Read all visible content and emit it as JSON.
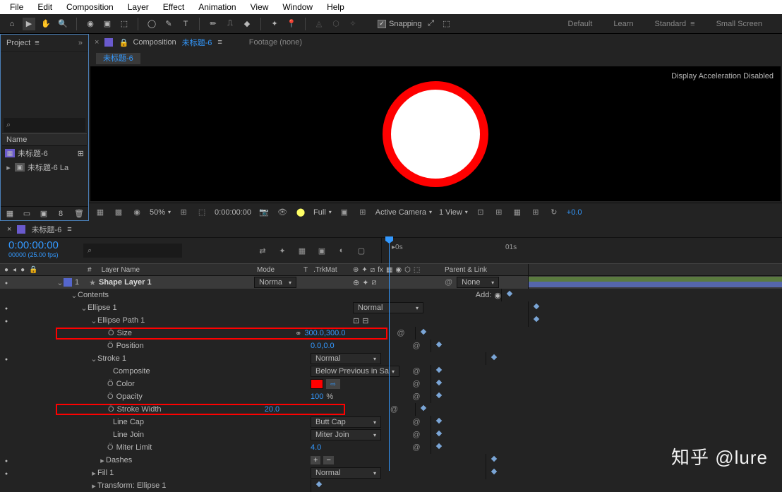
{
  "menu": [
    "File",
    "Edit",
    "Composition",
    "Layer",
    "Effect",
    "Animation",
    "View",
    "Window",
    "Help"
  ],
  "snapping": "Snapping",
  "workspaces": {
    "default": "Default",
    "learn": "Learn",
    "standard": "Standard",
    "small": "Small Screen"
  },
  "project": {
    "title": "Project",
    "name_hdr": "Name",
    "item1": "未标题-6",
    "item2": "未标题-6 La"
  },
  "comp": {
    "title": "Composition",
    "name": "未标题-6",
    "footage": "Footage  (none)",
    "accel": "Display Acceleration Disabled"
  },
  "viewbar": {
    "zoom": "50%",
    "tc": "0:00:00:00",
    "res": "Full",
    "cam": "Active Camera",
    "view": "1 View",
    "exp": "+0.0"
  },
  "timeline": {
    "tab": "未标题-6",
    "tc": "0:00:00:00",
    "fps": "00000 (25.00 fps)",
    "r0": "0s",
    "r1": "01s"
  },
  "cols": {
    "num": "#",
    "layername": "Layer Name",
    "mode": "Mode",
    "t": "T",
    "trkmat": ".TrkMat",
    "parent": "Parent & Link"
  },
  "layer": {
    "num": "1",
    "name": "Shape Layer 1",
    "mode": "Norma",
    "none": "None"
  },
  "tree": {
    "contents": "Contents",
    "add": "Add:",
    "ellipse1": "Ellipse 1",
    "normal": "Normal",
    "epath": "Ellipse Path 1",
    "size": "Size",
    "sizeval": "300.0,300.0",
    "position": "Position",
    "posval": "0.0,0.0",
    "stroke1": "Stroke 1",
    "composite": "Composite",
    "compval": "Below Previous in Sa",
    "color": "Color",
    "opacity": "Opacity",
    "opval": "100",
    "pct": "%",
    "swidth": "Stroke Width",
    "swval": "20.0",
    "linecap": "Line Cap",
    "capval": "Butt Cap",
    "linejoin": "Line Join",
    "joinval": "Miter Join",
    "miter": "Miter Limit",
    "mitval": "4.0",
    "dashes": "Dashes",
    "fill1": "Fill 1",
    "transform": "Transform: Ellipse 1"
  },
  "watermark": "知乎 @lure"
}
